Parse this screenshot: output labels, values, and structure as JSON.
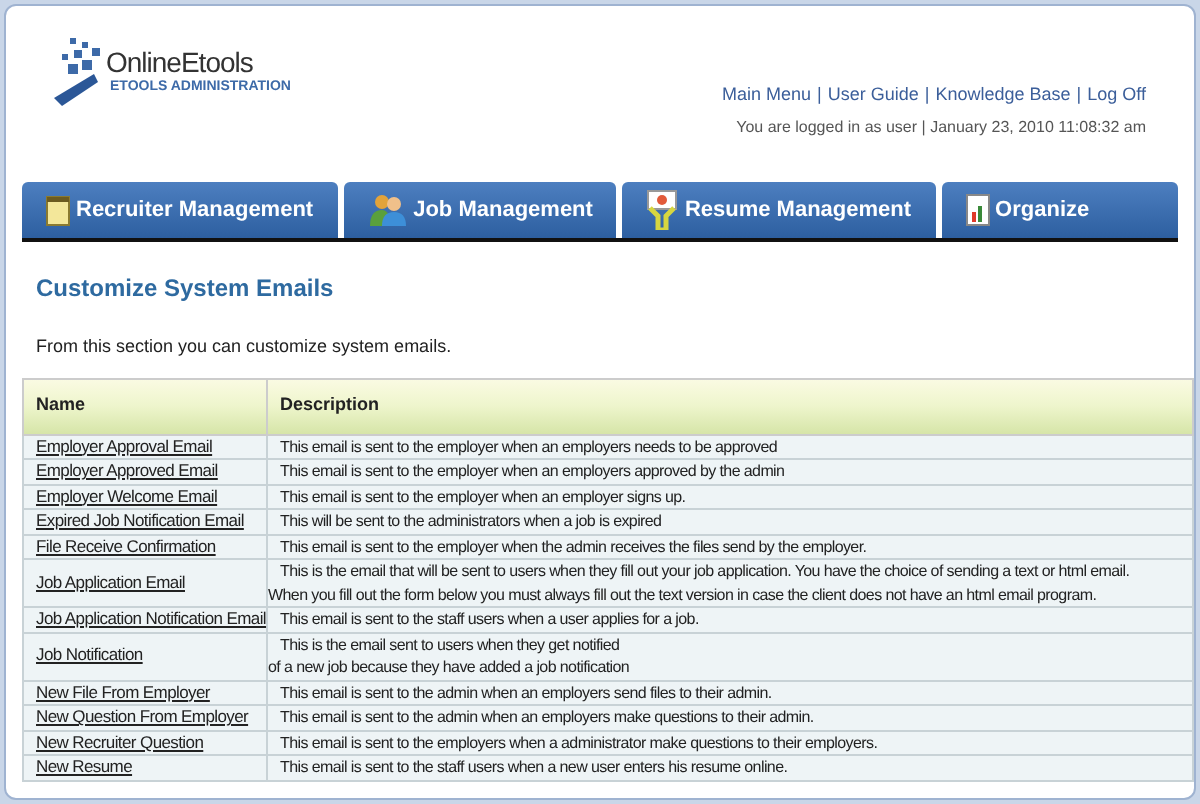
{
  "logo": {
    "name": "OnlineEtools",
    "subtitle": "ETOOLS ADMINISTRATION"
  },
  "top_links": [
    "Main Menu",
    "User Guide",
    "Knowledge Base",
    "Log Off"
  ],
  "link_separator": "|",
  "login_info": "You are logged in as user | January 23, 2010 11:08:32 am",
  "tabs": [
    {
      "label": "Recruiter Management",
      "kind": "notepad"
    },
    {
      "label": "Job Management",
      "kind": "people"
    },
    {
      "label": "Resume Management",
      "kind": "presenter"
    },
    {
      "label": "Organize",
      "kind": "report"
    }
  ],
  "page_title": "Customize System Emails",
  "intro": "From this section you can customize system emails.",
  "table": {
    "columns": [
      "Name",
      "Description"
    ],
    "rows": [
      {
        "name": "Employer Approval Email",
        "description": [
          "This email is sent to the employer when an employers needs to be approved"
        ]
      },
      {
        "name": "Employer Approved Email",
        "description": [
          "This email is sent to the employer when an employers approved by the admin"
        ]
      },
      {
        "name": "Employer Welcome Email",
        "description": [
          "This email is sent to the employer when an employer signs up."
        ]
      },
      {
        "name": "Expired Job Notification Email",
        "description": [
          "This will be sent to the administrators when a job is expired"
        ]
      },
      {
        "name": "File Receive Confirmation",
        "description": [
          "This email is sent to the employer when the admin receives the files send by the employer."
        ]
      },
      {
        "name": "Job Application Email",
        "description": [
          "This is the email that will be sent to users when they fill out your job application. You have the choice of sending a text or html email.",
          "When you fill out the form below you must always fill out the text version in case the client does not have an html email program."
        ]
      },
      {
        "name": "Job Application Notification Email",
        "description": [
          "This email is sent to the staff users when a user applies for a job."
        ]
      },
      {
        "name": "Job Notification",
        "description": [
          "This is the email sent to users when they get notified",
          "of a new job because they have added a job notification"
        ]
      },
      {
        "name": "New File From Employer",
        "description": [
          "This email is sent to the admin when an employers send files to their admin."
        ]
      },
      {
        "name": "New Question From Employer",
        "description": [
          "This email is sent to the admin when an employers make questions to their admin."
        ]
      },
      {
        "name": "New Recruiter Question",
        "description": [
          "This email is sent to the employers when a administrator make questions to their employers."
        ]
      },
      {
        "name": "New Resume",
        "description": [
          "This email is sent to the staff users when a new user enters his resume online."
        ]
      }
    ]
  }
}
